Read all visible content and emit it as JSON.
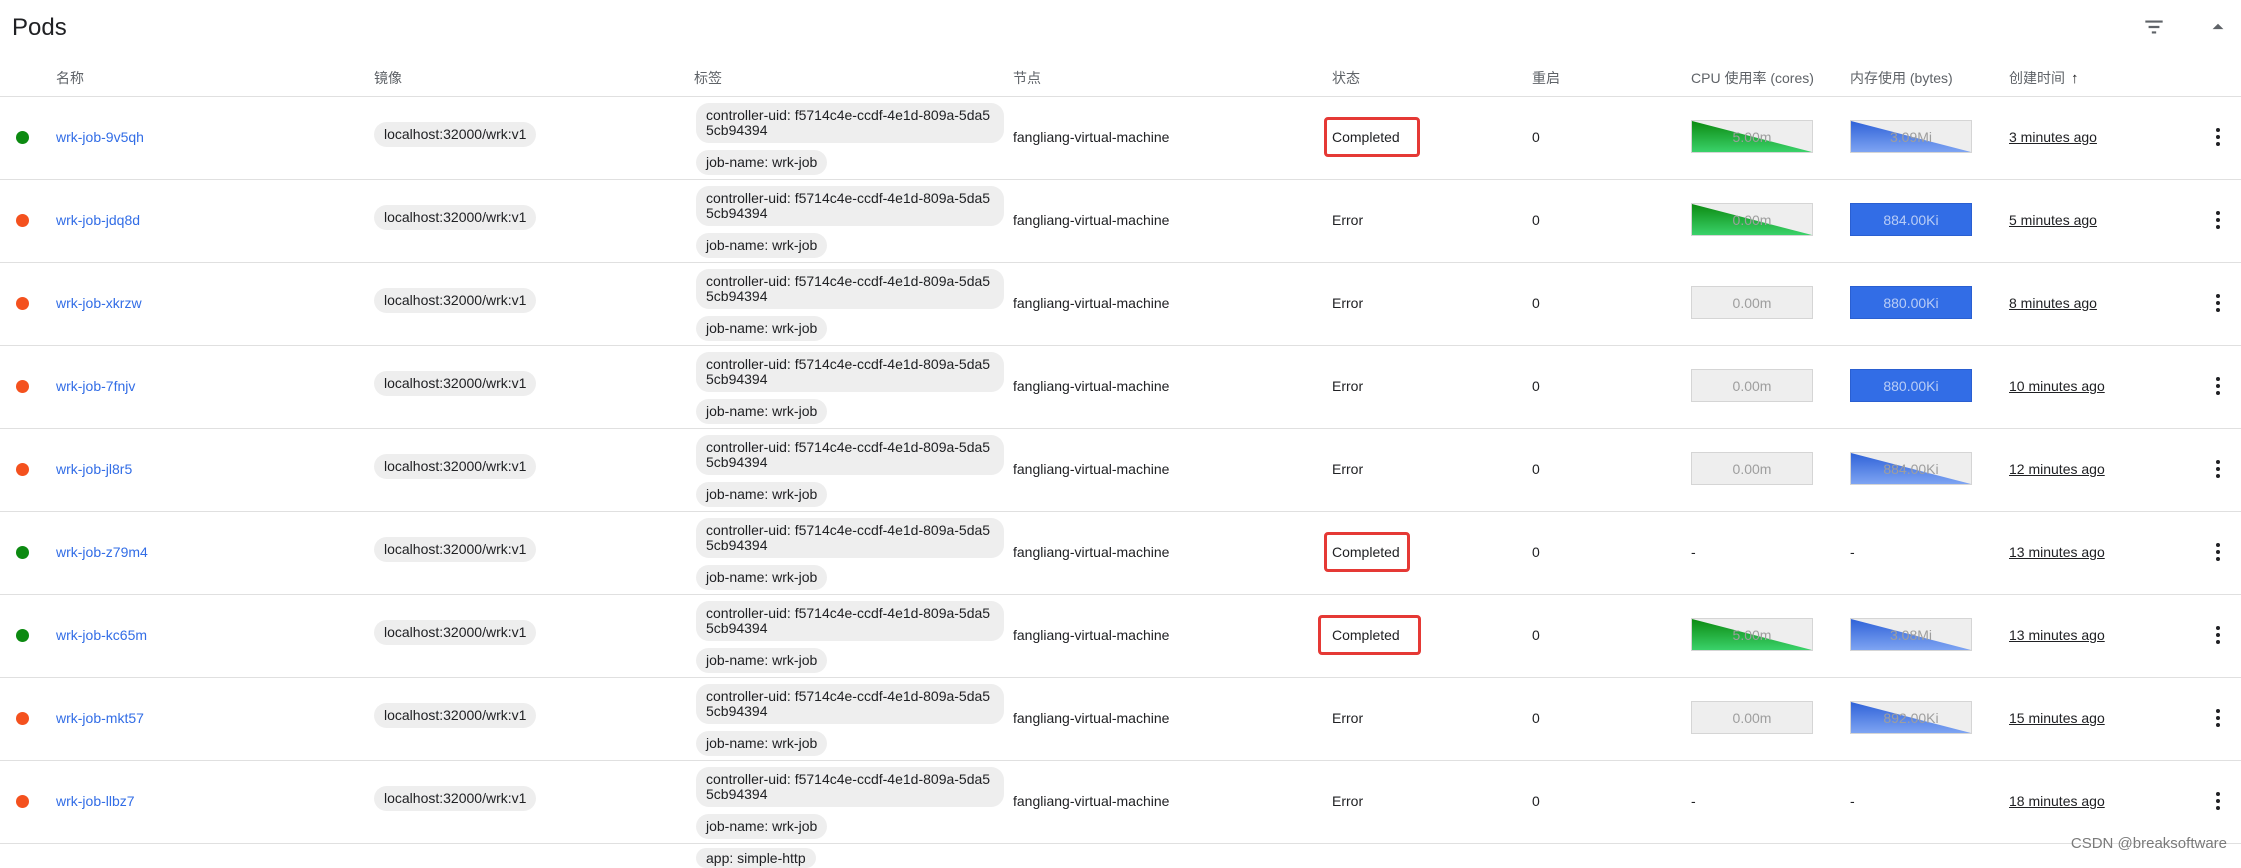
{
  "header": {
    "title": "Pods",
    "filter_icon": "filter-icon",
    "collapse_icon": "collapse-up-icon"
  },
  "columns": [
    "名称",
    "镜像",
    "标签",
    "节点",
    "状态",
    "重启",
    "CPU 使用率 (cores)",
    "内存使用 (bytes)",
    "创建时间"
  ],
  "sort_icon": "arrow-up-icon",
  "rows": [
    {
      "name": "wrk-job-9v5qh",
      "state": "ok",
      "image": "localhost:32000/wrk:v1",
      "label1": "controller-uid: f5714c4e-ccdf-4e1d-809a-5da55cb94394",
      "label2": "job-name: wrk-job",
      "node": "fangliang-virtual-machine",
      "status": "Completed",
      "highlight": true,
      "restarts": "0",
      "cpu": "5.00m",
      "cpu_style": "green",
      "mem": "3.09Mi",
      "mem_style": "blue-tri",
      "created": "3 minutes ago"
    },
    {
      "name": "wrk-job-jdq8d",
      "state": "err",
      "image": "localhost:32000/wrk:v1",
      "label1": "controller-uid: f5714c4e-ccdf-4e1d-809a-5da55cb94394",
      "label2": "job-name: wrk-job",
      "node": "fangliang-virtual-machine",
      "status": "Error",
      "highlight": false,
      "restarts": "0",
      "cpu": "0.00m",
      "cpu_style": "green",
      "mem": "884.00Ki",
      "mem_style": "blue-full",
      "created": "5 minutes ago"
    },
    {
      "name": "wrk-job-xkrzw",
      "state": "err",
      "image": "localhost:32000/wrk:v1",
      "label1": "controller-uid: f5714c4e-ccdf-4e1d-809a-5da55cb94394",
      "label2": "job-name: wrk-job",
      "node": "fangliang-virtual-machine",
      "status": "Error",
      "highlight": false,
      "restarts": "0",
      "cpu": "0.00m",
      "cpu_style": "empty",
      "mem": "880.00Ki",
      "mem_style": "blue-full",
      "created": "8 minutes ago"
    },
    {
      "name": "wrk-job-7fnjv",
      "state": "err",
      "image": "localhost:32000/wrk:v1",
      "label1": "controller-uid: f5714c4e-ccdf-4e1d-809a-5da55cb94394",
      "label2": "job-name: wrk-job",
      "node": "fangliang-virtual-machine",
      "status": "Error",
      "highlight": false,
      "restarts": "0",
      "cpu": "0.00m",
      "cpu_style": "empty",
      "mem": "880.00Ki",
      "mem_style": "blue-full",
      "created": "10 minutes ago"
    },
    {
      "name": "wrk-job-jl8r5",
      "state": "err",
      "image": "localhost:32000/wrk:v1",
      "label1": "controller-uid: f5714c4e-ccdf-4e1d-809a-5da55cb94394",
      "label2": "job-name: wrk-job",
      "node": "fangliang-virtual-machine",
      "status": "Error",
      "highlight": false,
      "restarts": "0",
      "cpu": "0.00m",
      "cpu_style": "empty",
      "mem": "884.00Ki",
      "mem_style": "blue-tri",
      "created": "12 minutes ago"
    },
    {
      "name": "wrk-job-z79m4",
      "state": "ok",
      "image": "localhost:32000/wrk:v1",
      "label1": "controller-uid: f5714c4e-ccdf-4e1d-809a-5da55cb94394",
      "label2": "job-name: wrk-job",
      "node": "fangliang-virtual-machine",
      "status": "Completed",
      "highlight": true,
      "restarts": "0",
      "cpu": "-",
      "cpu_style": "none",
      "mem": "-",
      "mem_style": "none",
      "created": "13 minutes ago"
    },
    {
      "name": "wrk-job-kc65m",
      "state": "ok",
      "image": "localhost:32000/wrk:v1",
      "label1": "controller-uid: f5714c4e-ccdf-4e1d-809a-5da55cb94394",
      "label2": "job-name: wrk-job",
      "node": "fangliang-virtual-machine",
      "status": "Completed",
      "highlight": true,
      "restarts": "0",
      "cpu": "5.00m",
      "cpu_style": "green",
      "mem": "3.08Mi",
      "mem_style": "blue-tri",
      "created": "13 minutes ago"
    },
    {
      "name": "wrk-job-mkt57",
      "state": "err",
      "image": "localhost:32000/wrk:v1",
      "label1": "controller-uid: f5714c4e-ccdf-4e1d-809a-5da55cb94394",
      "label2": "job-name: wrk-job",
      "node": "fangliang-virtual-machine",
      "status": "Error",
      "highlight": false,
      "restarts": "0",
      "cpu": "0.00m",
      "cpu_style": "empty",
      "mem": "892.00Ki",
      "mem_style": "blue-tri",
      "created": "15 minutes ago"
    },
    {
      "name": "wrk-job-llbz7",
      "state": "err",
      "image": "localhost:32000/wrk:v1",
      "label1": "controller-uid: f5714c4e-ccdf-4e1d-809a-5da55cb94394",
      "label2": "job-name: wrk-job",
      "node": "fangliang-virtual-machine",
      "status": "Error",
      "highlight": false,
      "restarts": "0",
      "cpu": "-",
      "cpu_style": "none",
      "mem": "-",
      "mem_style": "none",
      "created": "18 minutes ago"
    }
  ],
  "partial_row_label": "app: simple-http",
  "watermark": "CSDN @breaksoftware",
  "colors": {
    "link": "#326de6",
    "ok": "#0c8a11",
    "error": "#f4511e",
    "highlight": "#e53935",
    "cpu_green": "#1fa83e",
    "mem_blue": "#326de6"
  }
}
